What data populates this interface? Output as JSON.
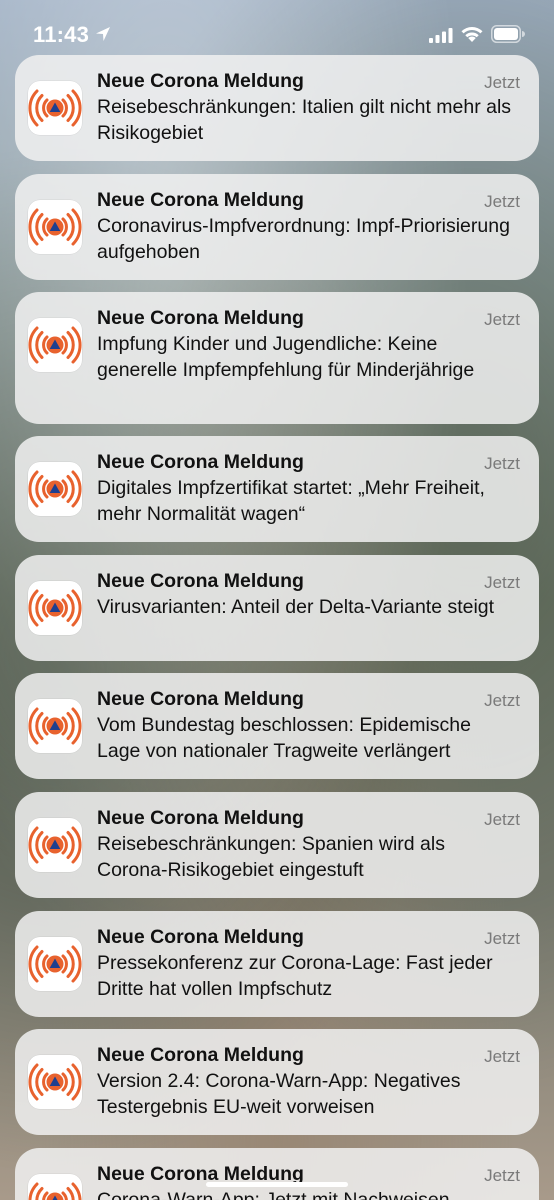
{
  "status_bar": {
    "time": "11:43",
    "icons": [
      "location-icon",
      "signal-icon",
      "wifi-icon",
      "battery-icon"
    ]
  },
  "app": {
    "icon": "warn-app-broadcast-icon",
    "icon_colors": {
      "waves": "#e8622e",
      "triangle": "#1d3f8f",
      "background": "#ffffff"
    }
  },
  "notifications": [
    {
      "title": "Neue Corona Meldung",
      "time": "Jetzt",
      "body": "Reisebeschränkungen: Italien gilt nicht mehr als Risikogebiet"
    },
    {
      "title": "Neue Corona Meldung",
      "time": "Jetzt",
      "body": "Coronavirus-Impfverordnung: Impf-Priorisierung aufgehoben"
    },
    {
      "title": "Neue Corona Meldung",
      "time": "Jetzt",
      "body": "Impfung Kinder und Jugendliche: Keine generelle Impfempfehlung für Minderjährige"
    },
    {
      "title": "Neue Corona Meldung",
      "time": "Jetzt",
      "body": "Digitales Impfzertifikat startet: „Mehr Freiheit, mehr Normalität wagen“"
    },
    {
      "title": "Neue Corona Meldung",
      "time": "Jetzt",
      "body": "Virusvarianten: Anteil der Delta-Variante steigt"
    },
    {
      "title": "Neue Corona Meldung",
      "time": "Jetzt",
      "body": "Vom Bundestag beschlossen: Epidemische Lage von nationaler Tragweite verlängert"
    },
    {
      "title": "Neue Corona Meldung",
      "time": "Jetzt",
      "body": "Reisebeschränkungen: Spanien wird als Corona-Risikogebiet eingestuft"
    },
    {
      "title": "Neue Corona Meldung",
      "time": "Jetzt",
      "body": "Pressekonferenz zur Corona-Lage: Fast jeder Dritte hat vollen Impfschutz"
    },
    {
      "title": "Neue Corona Meldung",
      "time": "Jetzt",
      "body": "Version 2.4: Corona-Warn-App: Negatives Testergebnis EU-weit vorweisen"
    },
    {
      "title": "Neue Corona Meldung",
      "time": "Jetzt",
      "body": "Corona-Warn-App: Jetzt mit Nachweisen"
    }
  ]
}
